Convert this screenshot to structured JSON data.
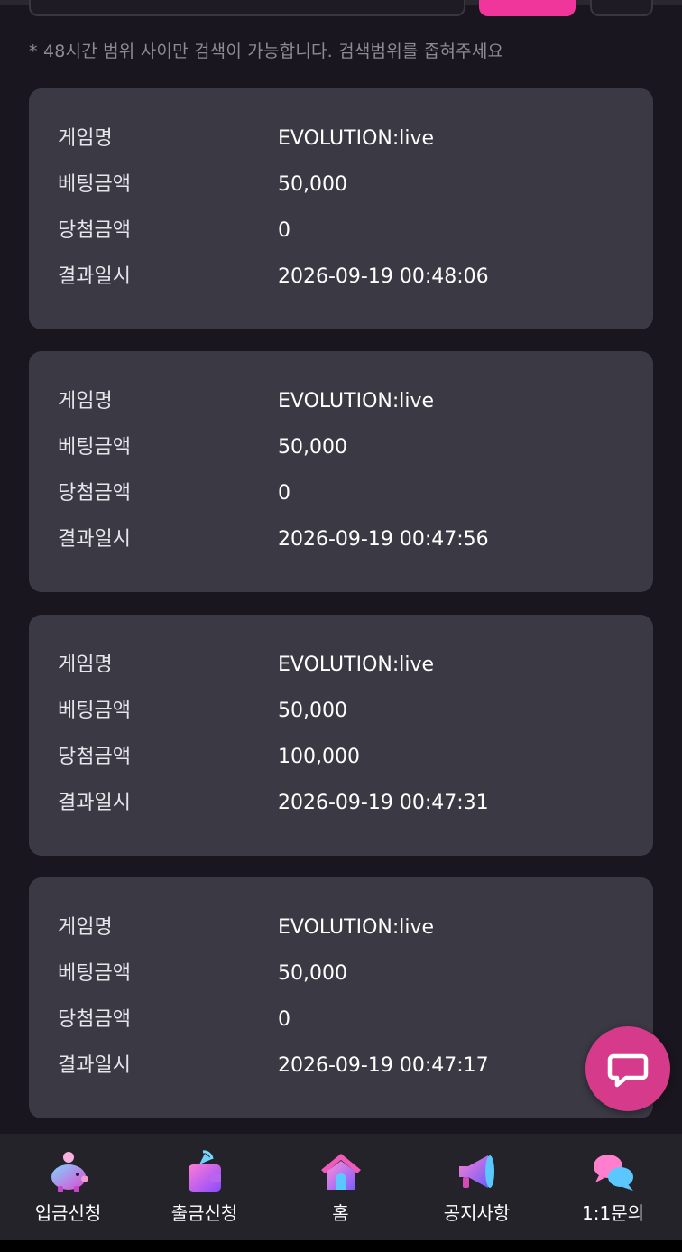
{
  "notice": "* 48시간 범위 사이만 검색이 가능합니다. 검색범위를 좁혀주세요",
  "cards": [
    {
      "game_label": "게임명",
      "game": "EVOLUTION:live",
      "bet_label": "베팅금액",
      "bet": "50,000",
      "win_label": "당첨금액",
      "win": "0",
      "time_label": "결과일시",
      "time": "2026-09-19 00:48:06"
    },
    {
      "game_label": "게임명",
      "game": "EVOLUTION:live",
      "bet_label": "베팅금액",
      "bet": "50,000",
      "win_label": "당첨금액",
      "win": "0",
      "time_label": "결과일시",
      "time": "2026-09-19 00:47:56"
    },
    {
      "game_label": "게임명",
      "game": "EVOLUTION:live",
      "bet_label": "베팅금액",
      "bet": "50,000",
      "win_label": "당첨금액",
      "win": "100,000",
      "time_label": "결과일시",
      "time": "2026-09-19 00:47:31"
    },
    {
      "game_label": "게임명",
      "game": "EVOLUTION:live",
      "bet_label": "베팅금액",
      "bet": "50,000",
      "win_label": "당첨금액",
      "win": "0",
      "time_label": "결과일시",
      "time": "2026-09-19 00:47:17"
    }
  ],
  "nav": [
    {
      "label": "입금신청",
      "icon": "piggy-bank-icon"
    },
    {
      "label": "출금신청",
      "icon": "wallet-icon"
    },
    {
      "label": "홈",
      "icon": "home-icon"
    },
    {
      "label": "공지사항",
      "icon": "megaphone-icon"
    },
    {
      "label": "1:1문의",
      "icon": "chat-bubbles-icon"
    }
  ],
  "colors": {
    "accent": "#f0359b",
    "card": "#3a3944",
    "background": "#1a161f",
    "fab": "#d63a8a"
  }
}
